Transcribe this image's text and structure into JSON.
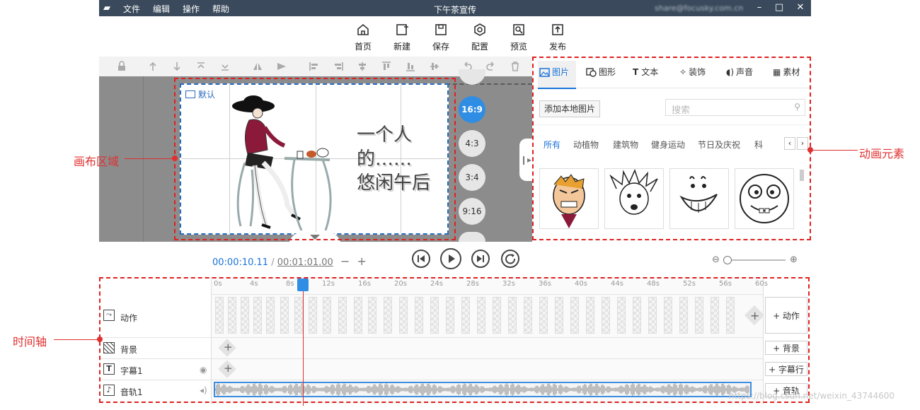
{
  "titlebar": {
    "menu": [
      "文件",
      "编辑",
      "操作",
      "帮助"
    ],
    "title": "下午茶宣传",
    "account": "share@focusky.com.cn"
  },
  "toolbar": {
    "home": "首页",
    "new": "新建",
    "save": "保存",
    "config": "配置",
    "preview": "预览",
    "publish": "发布"
  },
  "canvas": {
    "default_label": "默认",
    "text_line1": "一个人",
    "text_line2": "的……",
    "text_line3": "悠闲午后",
    "ratios": [
      "16:9",
      "4:3",
      "3:4",
      "9:16"
    ],
    "active_ratio": "16:9"
  },
  "panel": {
    "tabs": [
      "图片",
      "图形",
      "文本",
      "装饰",
      "声音",
      "素材"
    ],
    "add_local": "添加本地图片",
    "search_placeholder": "搜索",
    "categories": [
      "所有",
      "动植物",
      "建筑物",
      "健身运动",
      "节日及庆祝",
      "科"
    ]
  },
  "playback": {
    "current": "00:00:10.11",
    "separator": "/",
    "total": "00:01:01.00",
    "minus": "−",
    "plus": "+"
  },
  "timeline": {
    "ruler": [
      "0s",
      "4s",
      "8s",
      "12s",
      "16s",
      "20s",
      "24s",
      "28s",
      "32s",
      "36s",
      "40s",
      "44s",
      "48s",
      "52s",
      "56s",
      "60s"
    ],
    "rows": {
      "action": "动作",
      "background": "背景",
      "subtitle": "字幕1",
      "audio": "音轨1"
    },
    "add_buttons": {
      "action": "+ 动作",
      "background": "+ 背景",
      "subtitle": "+ 字幕行",
      "audio": "+ 音轨"
    }
  },
  "annotations": {
    "canvas": "画布区域",
    "elements": "动画元素",
    "timeline": "时间轴"
  },
  "watermark": "https://blog.csdn.net/weixin_43744600",
  "colors": {
    "accent": "#2f8de4",
    "annotation": "#e02020",
    "titlebar": "#3a4a5c"
  }
}
